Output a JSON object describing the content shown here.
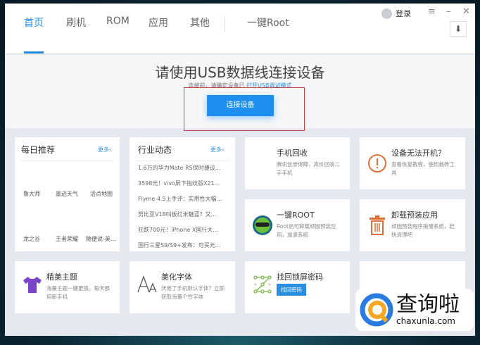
{
  "nav": {
    "tabs": [
      "首页",
      "刷机",
      "ROM",
      "应用",
      "其他",
      "一键Root"
    ],
    "active": "首页",
    "login": "登录"
  },
  "hero": {
    "title": "请使用USB数据线连接设备",
    "sub_prefix": "连接前，请确定设备已",
    "sub_link": "打开USB调试模式",
    "button": "连接设备"
  },
  "daily": {
    "title": "每日推荐",
    "more": "更多›",
    "apps": [
      "鲁大师",
      "墨迹天气",
      "活点地图",
      "龙之谷",
      "王者荣耀",
      "随便说-英..."
    ]
  },
  "news": {
    "title": "行业动态",
    "more": "更多›",
    "items": [
      "1.6万的华为Mate RS保时捷设...",
      "3598元！vivo屏下指纹版X21...",
      "Flyme 4.5上手评：实用性大幅...",
      "努比亚V18叫板红米魅蓝？又...",
      "狂跌700元！iPhone X国行大...",
      "国行三星S9/S9+发布：可买元..."
    ]
  },
  "features": [
    {
      "title": "手机回收",
      "desc": "腾讯信誉保障，高价回收二手手机",
      "icon": "phone-recycle-icon"
    },
    {
      "title": "设备无法开机？",
      "desc": "查看恢复教程，使用救砖工具",
      "icon": "warning-icon",
      "color": "#e0703a"
    },
    {
      "title": "一键ROOT",
      "desc": "Root后可卸载顽固预装应用，加速系统",
      "icon": "root-mascot-icon"
    },
    {
      "title": "卸载预装应用",
      "desc": "顽固预装程序拖慢系统，赶快清理吧",
      "icon": "trash-icon",
      "color": "#e0703a"
    },
    {
      "title": "精美主题",
      "desc": "海量主题一键更换，每天都用新手机",
      "icon": "tshirt-icon",
      "color": "#7a45c8"
    },
    {
      "title": "美化字体",
      "desc": "厌倦了手机默认字体？立即获取海量个性字体",
      "icon": "font-icon"
    },
    {
      "title": "找回锁屏密码",
      "button": "找回密码",
      "icon": "pattern-lock-icon"
    }
  ],
  "watermark": {
    "text": "查询啦",
    "domain": "chaxunla.com"
  },
  "colors": {
    "accent": "#2a8fe0",
    "highlight": "#c8403e"
  }
}
